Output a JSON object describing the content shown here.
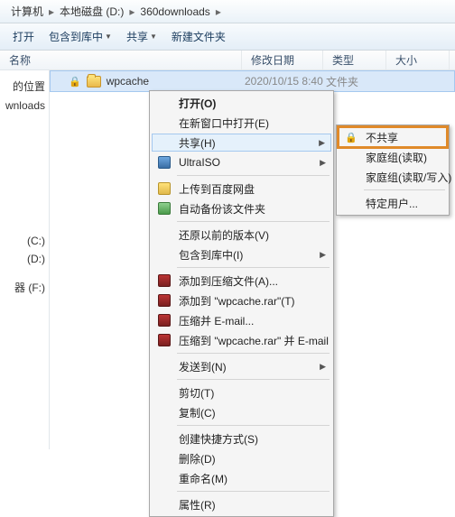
{
  "crumb": {
    "a": "计算机",
    "b": "本地磁盘 (D:)",
    "c": "360downloads"
  },
  "tb": {
    "open": "打开",
    "include": "包含到库中",
    "share": "共享",
    "newf": "新建文件夹"
  },
  "cols": {
    "name": "名称",
    "date": "修改日期",
    "type": "类型",
    "size": "大小"
  },
  "nav": {
    "i0": "的位置",
    "i1": "wnloads",
    "i2": "(C:)",
    "i3": "(D:)",
    "i4": "器 (F:)"
  },
  "file": {
    "name": "wpcache",
    "date": "2020/10/15 8:40",
    "type": "文件夹"
  },
  "menu": {
    "open": "打开(O)",
    "newwin": "在新窗口中打开(E)",
    "share": "共享(H)",
    "ultra": "UltraISO",
    "baidu": "上传到百度网盘",
    "autobak": "自动备份该文件夹",
    "restore": "还原以前的版本(V)",
    "tolib": "包含到库中(I)",
    "addzip": "添加到压缩文件(A)...",
    "addrar": "添加到 \"wpcache.rar\"(T)",
    "zipmail": "压缩并 E-mail...",
    "zipmail2": "压缩到 \"wpcache.rar\" 并 E-mail",
    "sendto": "发送到(N)",
    "cut": "剪切(T)",
    "copy": "复制(C)",
    "shortcut": "创建快捷方式(S)",
    "delete": "删除(D)",
    "rename": "重命名(M)",
    "props": "属性(R)"
  },
  "submenu": {
    "noshare": "不共享",
    "hgread": "家庭组(读取)",
    "hgrw": "家庭组(读取/写入)",
    "specuser": "特定用户..."
  }
}
